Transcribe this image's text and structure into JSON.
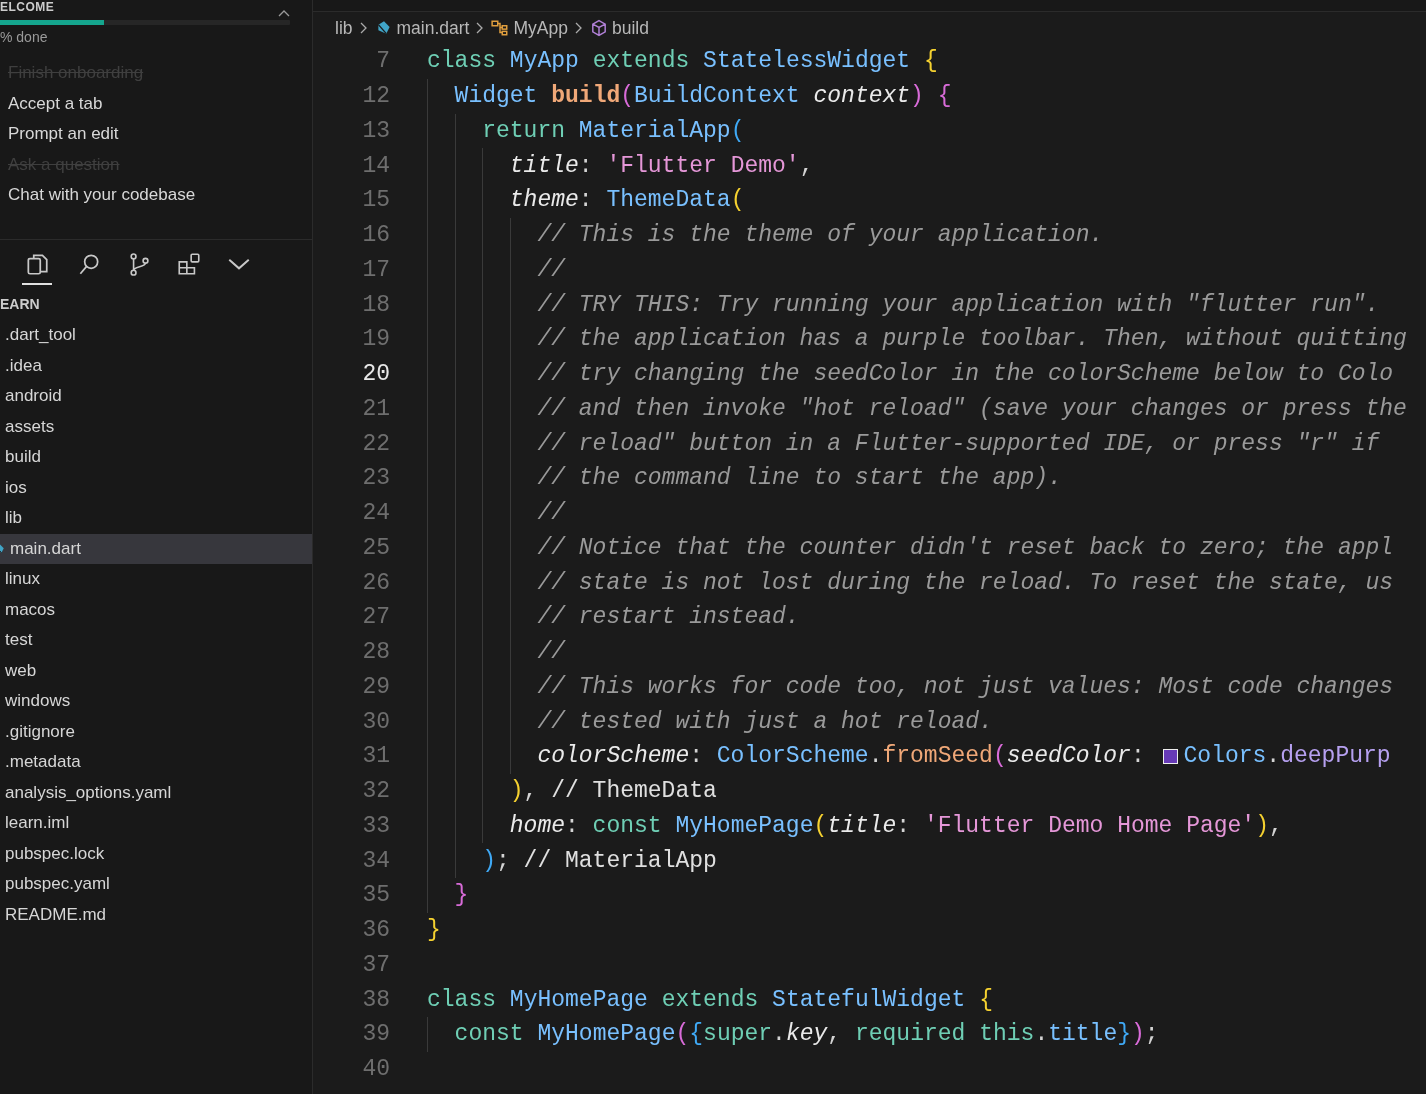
{
  "welcome": {
    "title": "ELCOME",
    "progress": {
      "level": 0.36,
      "reading": "% done"
    },
    "checklist": [
      {
        "label": "Finish onboarding",
        "done": true
      },
      {
        "label": "Accept a tab",
        "done": false
      },
      {
        "label": "Prompt an edit",
        "done": false
      },
      {
        "label": "Ask a question",
        "done": true
      },
      {
        "label": "Chat with your codebase",
        "done": false
      }
    ]
  },
  "activity_bar": [
    {
      "kind": "files",
      "selected": true
    },
    {
      "kind": "search",
      "selected": false
    },
    {
      "kind": "source-control",
      "selected": false
    },
    {
      "kind": "extensions",
      "selected": false
    },
    {
      "kind": "more",
      "selected": false
    }
  ],
  "explorer": {
    "title": "EARN",
    "items": [
      {
        "label": ".dart_tool",
        "kind": "folder",
        "selected": false
      },
      {
        "label": ".idea",
        "kind": "folder",
        "selected": false
      },
      {
        "label": "android",
        "kind": "folder",
        "selected": false
      },
      {
        "label": "assets",
        "kind": "folder",
        "selected": false
      },
      {
        "label": "build",
        "kind": "folder",
        "selected": false
      },
      {
        "label": "ios",
        "kind": "folder",
        "selected": false
      },
      {
        "label": "lib",
        "kind": "folder",
        "selected": false
      },
      {
        "label": "main.dart",
        "kind": "dart",
        "selected": true
      },
      {
        "label": "linux",
        "kind": "folder",
        "selected": false
      },
      {
        "label": "macos",
        "kind": "folder",
        "selected": false
      },
      {
        "label": "test",
        "kind": "folder",
        "selected": false
      },
      {
        "label": "web",
        "kind": "folder",
        "selected": false
      },
      {
        "label": "windows",
        "kind": "folder",
        "selected": false
      },
      {
        "label": ".gitignore",
        "kind": "file",
        "selected": false
      },
      {
        "label": ".metadata",
        "kind": "file",
        "selected": false
      },
      {
        "label": "analysis_options.yaml",
        "kind": "file",
        "selected": false
      },
      {
        "label": "learn.iml",
        "kind": "file",
        "selected": false
      },
      {
        "label": "pubspec.lock",
        "kind": "file",
        "selected": false
      },
      {
        "label": "pubspec.yaml",
        "kind": "file",
        "selected": false
      },
      {
        "label": "README.md",
        "kind": "file",
        "selected": false
      }
    ]
  },
  "breadcrumbs": [
    {
      "label": "lib",
      "kind": "folder"
    },
    {
      "label": "main.dart",
      "kind": "dart"
    },
    {
      "label": "MyApp",
      "kind": "class"
    },
    {
      "label": "build",
      "kind": "method"
    }
  ],
  "editor": {
    "lines": [
      {
        "number": "7",
        "active": false,
        "tokens": [
          {
            "kind": "kw",
            "text": "class "
          },
          {
            "kind": "type",
            "text": "MyApp "
          },
          {
            "kind": "kw",
            "text": "extends "
          },
          {
            "kind": "type",
            "text": "StatelessWidget "
          },
          {
            "kind": "b1",
            "text": "{"
          }
        ]
      },
      {
        "number": "12",
        "active": false,
        "tokens": [
          {
            "kind": "type",
            "text": "  Widget "
          },
          {
            "kind": "fn",
            "text": "build"
          },
          {
            "kind": "b2",
            "text": "("
          },
          {
            "kind": "type",
            "text": "BuildContext "
          },
          {
            "kind": "param",
            "text": "context"
          },
          {
            "kind": "b2",
            "text": ") {"
          }
        ]
      },
      {
        "number": "13",
        "active": false,
        "tokens": [
          {
            "kind": "kw",
            "text": "    return "
          },
          {
            "kind": "type",
            "text": "MaterialApp"
          },
          {
            "kind": "b3",
            "text": "("
          }
        ]
      },
      {
        "number": "14",
        "active": false,
        "tokens": [
          {
            "kind": "param",
            "text": "      title"
          },
          {
            "kind": "punc",
            "text": ": "
          },
          {
            "kind": "str",
            "text": "'Flutter Demo'"
          },
          {
            "kind": "punc",
            "text": ","
          }
        ]
      },
      {
        "number": "15",
        "active": false,
        "tokens": [
          {
            "kind": "param",
            "text": "      theme"
          },
          {
            "kind": "punc",
            "text": ": "
          },
          {
            "kind": "type",
            "text": "ThemeData"
          },
          {
            "kind": "b1",
            "text": "("
          }
        ]
      },
      {
        "number": "16",
        "active": false,
        "tokens": [
          {
            "kind": "cmt",
            "text": "        // This is the theme of your application."
          }
        ]
      },
      {
        "number": "17",
        "active": false,
        "tokens": [
          {
            "kind": "cmt",
            "text": "        //"
          }
        ]
      },
      {
        "number": "18",
        "active": false,
        "tokens": [
          {
            "kind": "cmt",
            "text": "        // TRY THIS: Try running your application with \"flutter run\"."
          }
        ]
      },
      {
        "number": "19",
        "active": false,
        "tokens": [
          {
            "kind": "cmt",
            "text": "        // the application has a purple toolbar. Then, without quitting"
          }
        ]
      },
      {
        "number": "20",
        "active": true,
        "tokens": [
          {
            "kind": "cmt",
            "text": "        // try changing the seedColor in the colorScheme below to Colo"
          }
        ]
      },
      {
        "number": "21",
        "active": false,
        "tokens": [
          {
            "kind": "cmt",
            "text": "        // and then invoke \"hot reload\" (save your changes or press the"
          }
        ]
      },
      {
        "number": "22",
        "active": false,
        "tokens": [
          {
            "kind": "cmt",
            "text": "        // reload\" button in a Flutter-supported IDE, or press \"r\" if"
          }
        ]
      },
      {
        "number": "23",
        "active": false,
        "tokens": [
          {
            "kind": "cmt",
            "text": "        // the command line to start the app)."
          }
        ]
      },
      {
        "number": "24",
        "active": false,
        "tokens": [
          {
            "kind": "cmt",
            "text": "        //"
          }
        ]
      },
      {
        "number": "25",
        "active": false,
        "tokens": [
          {
            "kind": "cmt",
            "text": "        // Notice that the counter didn't reset back to zero; the appl"
          }
        ]
      },
      {
        "number": "26",
        "active": false,
        "tokens": [
          {
            "kind": "cmt",
            "text": "        // state is not lost during the reload. To reset the state, us"
          }
        ]
      },
      {
        "number": "27",
        "active": false,
        "tokens": [
          {
            "kind": "cmt",
            "text": "        // restart instead."
          }
        ]
      },
      {
        "number": "28",
        "active": false,
        "tokens": [
          {
            "kind": "cmt",
            "text": "        //"
          }
        ]
      },
      {
        "number": "29",
        "active": false,
        "tokens": [
          {
            "kind": "cmt",
            "text": "        // This works for code too, not just values: Most code changes"
          }
        ]
      },
      {
        "number": "30",
        "active": false,
        "tokens": [
          {
            "kind": "cmt",
            "text": "        // tested with just a hot reload."
          }
        ]
      },
      {
        "number": "31",
        "active": false,
        "tokens": [
          {
            "kind": "param",
            "text": "        colorScheme"
          },
          {
            "kind": "punc",
            "text": ": "
          },
          {
            "kind": "type",
            "text": "ColorScheme"
          },
          {
            "kind": "punc",
            "text": "."
          },
          {
            "kind": "fnplain",
            "text": "fromSeed"
          },
          {
            "kind": "b2",
            "text": "("
          },
          {
            "kind": "param",
            "text": "seedColor"
          },
          {
            "kind": "punc",
            "text": ": "
          },
          {
            "kind": "swatch",
            "color": "#673ab7"
          },
          {
            "kind": "type",
            "text": "Colors"
          },
          {
            "kind": "punc",
            "text": "."
          },
          {
            "kind": "prop",
            "text": "deepPurp"
          }
        ]
      },
      {
        "number": "32",
        "active": false,
        "tokens": [
          {
            "kind": "b1",
            "text": "      )"
          },
          {
            "kind": "punc",
            "text": ", "
          },
          {
            "kind": "hint",
            "text": "// ThemeData"
          }
        ]
      },
      {
        "number": "33",
        "active": false,
        "tokens": [
          {
            "kind": "param",
            "text": "      home"
          },
          {
            "kind": "punc",
            "text": ": "
          },
          {
            "kind": "kw",
            "text": "const "
          },
          {
            "kind": "type",
            "text": "MyHomePage"
          },
          {
            "kind": "b1",
            "text": "("
          },
          {
            "kind": "param",
            "text": "title"
          },
          {
            "kind": "punc",
            "text": ": "
          },
          {
            "kind": "str",
            "text": "'Flutter Demo Home Page'"
          },
          {
            "kind": "b1",
            "text": ")"
          },
          {
            "kind": "punc",
            "text": ","
          }
        ]
      },
      {
        "number": "34",
        "active": false,
        "tokens": [
          {
            "kind": "b3",
            "text": "    )"
          },
          {
            "kind": "punc",
            "text": "; "
          },
          {
            "kind": "hint",
            "text": "// MaterialApp"
          }
        ]
      },
      {
        "number": "35",
        "active": false,
        "tokens": [
          {
            "kind": "b2",
            "text": "  }"
          }
        ]
      },
      {
        "number": "36",
        "active": false,
        "tokens": [
          {
            "kind": "b1",
            "text": "}"
          }
        ]
      },
      {
        "number": "37",
        "active": false
      },
      {
        "number": "38",
        "active": false,
        "tokens": [
          {
            "kind": "kw",
            "text": "class "
          },
          {
            "kind": "type",
            "text": "MyHomePage "
          },
          {
            "kind": "kw",
            "text": "extends "
          },
          {
            "kind": "type",
            "text": "StatefulWidget "
          },
          {
            "kind": "b1",
            "text": "{"
          }
        ]
      },
      {
        "number": "39",
        "active": false,
        "tokens": [
          {
            "kind": "kw",
            "text": "  const "
          },
          {
            "kind": "type",
            "text": "MyHomePage"
          },
          {
            "kind": "b2",
            "text": "("
          },
          {
            "kind": "b3",
            "text": "{"
          },
          {
            "kind": "kw",
            "text": "super"
          },
          {
            "kind": "punc",
            "text": "."
          },
          {
            "kind": "param",
            "text": "key"
          },
          {
            "kind": "punc",
            "text": ", "
          },
          {
            "kind": "kw",
            "text": "required this"
          },
          {
            "kind": "punc",
            "text": "."
          },
          {
            "kind": "type",
            "text": "title"
          },
          {
            "kind": "b3",
            "text": "}"
          },
          {
            "kind": "b2",
            "text": ")"
          },
          {
            "kind": "punc",
            "text": ";"
          }
        ]
      },
      {
        "number": "40",
        "active": false
      }
    ]
  }
}
